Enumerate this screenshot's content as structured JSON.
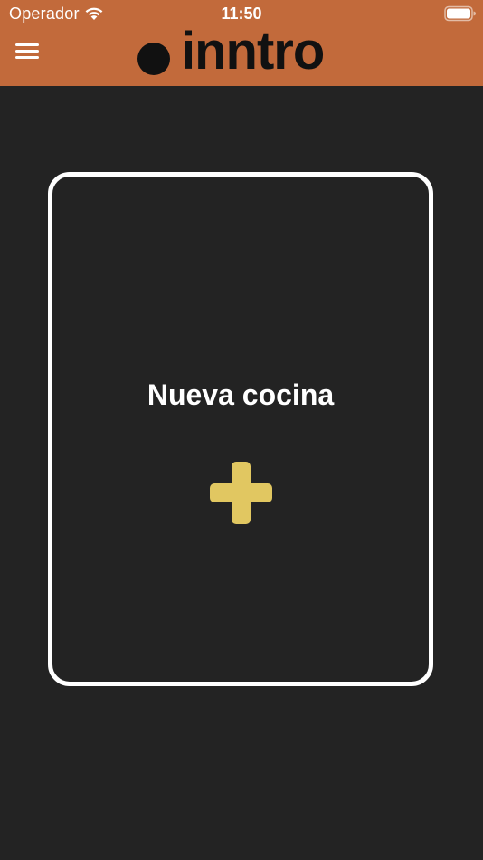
{
  "status_bar": {
    "carrier": "Operador",
    "time": "11:50",
    "wifi_icon": "wifi-icon",
    "battery_icon": "battery-icon"
  },
  "header": {
    "menu_icon": "hamburger-menu-icon",
    "logo_text": "inntro",
    "background_color": "#c26a3b"
  },
  "card": {
    "title": "Nueva cocina",
    "icon": "plus-icon",
    "icon_color": "#e1c761",
    "border_color": "#ffffff"
  },
  "colors": {
    "background": "#232323"
  }
}
